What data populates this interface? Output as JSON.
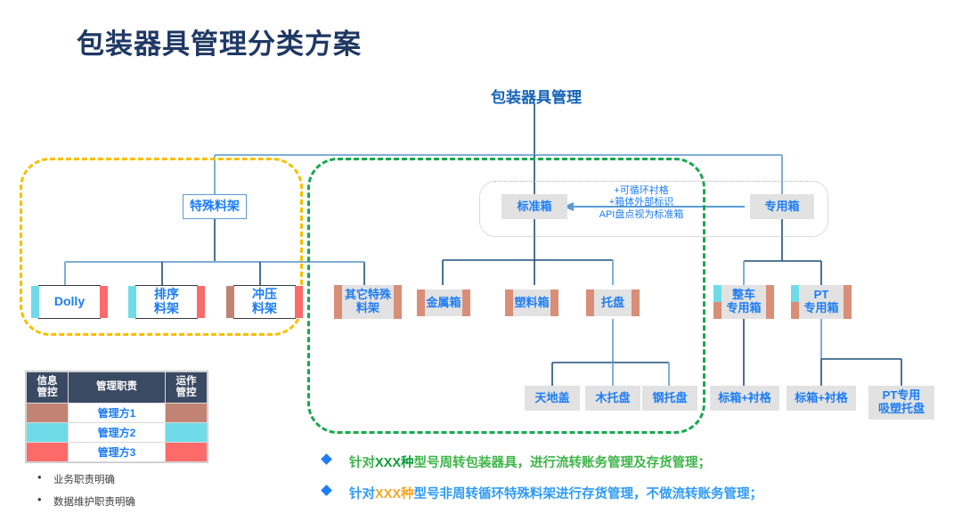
{
  "title": "包装器具管理分类方案",
  "root": {
    "label": "包装器具管理"
  },
  "nodes": {
    "special_rack": "特殊料架",
    "standard_box": "标准箱",
    "dedicated_box": "专用箱",
    "dolly": "Dolly",
    "sort_rack_l1": "排序",
    "sort_rack_l2": "料架",
    "stamp_rack_l1": "冲压",
    "stamp_rack_l2": "料架",
    "other_special_l1": "其它特殊",
    "other_special_l2": "料架",
    "metal_box": "金属箱",
    "plastic_box": "塑料箱",
    "pallet": "托盘",
    "vehicle_box_l1": "整车",
    "vehicle_box_l2": "专用箱",
    "pt_box_l1": "PT",
    "pt_box_l2": "专用箱",
    "tiandi_cover": "天地盖",
    "wood_pallet": "木托盘",
    "steel_pallet": "钢托盘",
    "std_liner_1": "标箱+衬格",
    "std_liner_2": "标箱+衬格",
    "pt_tray_l1": "PT专用",
    "pt_tray_l2": "吸塑托盘"
  },
  "annotation": {
    "line1": "+可循环衬格",
    "line2": "+箱体外部标识",
    "line3": "API盘点视为标准箱"
  },
  "legend": {
    "headers": [
      "信息管控",
      "管理职责",
      "运作管控"
    ],
    "header_parts": [
      [
        "信息",
        "管控"
      ],
      [
        "管理职责"
      ],
      [
        "运作",
        "管控"
      ]
    ],
    "rows": [
      {
        "label": "管理方1",
        "color": "#c08374"
      },
      {
        "label": "管理方2",
        "color": "#6fdbe8"
      },
      {
        "label": "管理方3",
        "color": "#fc6a6a"
      }
    ]
  },
  "bullets": [
    "业务职责明确",
    "数据维护职责明确"
  ],
  "notes": [
    {
      "pre": "针对",
      "hl": "XXX种",
      "post": "型号周转包装器具，进行流转账务管理及存货管理；"
    },
    {
      "pre": " 针对",
      "hl": "XXX种",
      "post": "型号非周转循环特殊料架进行存货管理，不做流转账务管理；"
    }
  ],
  "colors": {
    "title": "#1f3864",
    "node_text": "#1d7df5",
    "node_grey_fill": "#e2e2e2",
    "wire": "#1f4e79",
    "wire_light": "#7faed4",
    "bar_cyan": "#6fdbe8",
    "bar_red": "#fc6a6a",
    "bar_brown": "#c08374",
    "bar_salmon": "#d98e78",
    "group_yellow": "#f7bf00",
    "group_green": "#17a84f",
    "note_green": "#3fb54a",
    "note_blue": "#2f9bf5",
    "note_orange": "#f5a623"
  }
}
